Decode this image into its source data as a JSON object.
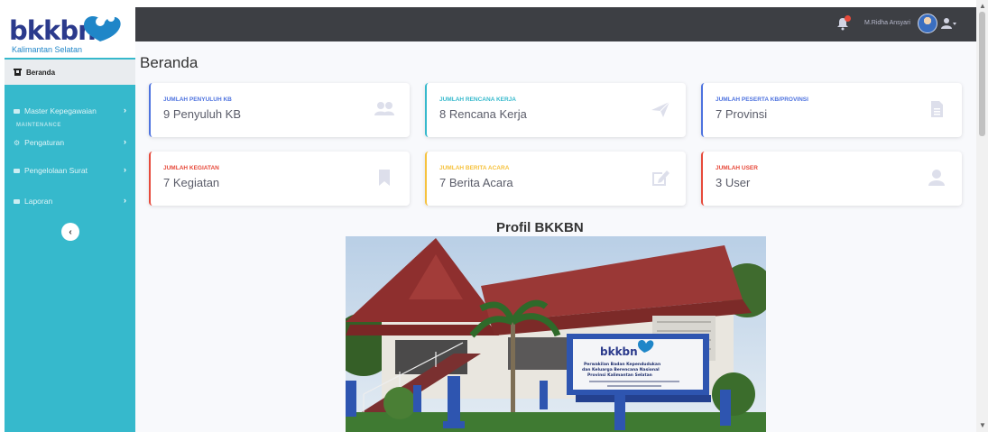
{
  "brand": {
    "name": "bkkbn",
    "subtitle": "Kalimantan Selatan"
  },
  "sidebar": {
    "active": {
      "label": "Beranda",
      "icon": "home-icon"
    },
    "items": [
      {
        "label": "Master Kepegawaian",
        "icon": "folder-icon"
      },
      {
        "label": "Pengaturan",
        "icon": "gear-icon"
      },
      {
        "label": "Pengelolaan Surat",
        "icon": "folder-icon"
      },
      {
        "label": "Laporan",
        "icon": "folder-icon"
      }
    ],
    "section_label": "MAINTENANCE",
    "toggle_icon": "‹"
  },
  "topbar": {
    "user_name": "M.Ridha Ansyari",
    "badge_color": "#e74a3b"
  },
  "page": {
    "title": "Beranda"
  },
  "cards": [
    {
      "title": "JUMLAH PENYULUH KB",
      "value": "9 Penyuluh KB",
      "color": "#4e73df",
      "icon": "users-icon"
    },
    {
      "title": "JUMLAH RENCANA KERJA",
      "value": "8 Rencana Kerja",
      "color": "#36b9cc",
      "icon": "paper-plane-icon"
    },
    {
      "title": "JUMLAH PESERTA KB/PROVINSI",
      "value": "7 Provinsi",
      "color": "#4e73df",
      "icon": "file-icon"
    },
    {
      "title": "JUMLAH KEGIATAN",
      "value": "7 Kegiatan",
      "color": "#e74a3b",
      "icon": "bookmark-icon"
    },
    {
      "title": "JUMLAH BERITA ACARA",
      "value": "7 Berita Acara",
      "color": "#f6c23e",
      "icon": "edit-icon"
    },
    {
      "title": "JUMLAH USER",
      "value": "3 User",
      "color": "#e74a3b",
      "icon": "user-icon"
    }
  ],
  "profil": {
    "title": "Profil BKKBN",
    "sign_brand": "bkkbn",
    "sign_lines": [
      "Perwakilan Badan Kependudukan",
      "dan Keluarga Berencana Nasional",
      "Provinsi Kalimantan Selatan"
    ]
  }
}
